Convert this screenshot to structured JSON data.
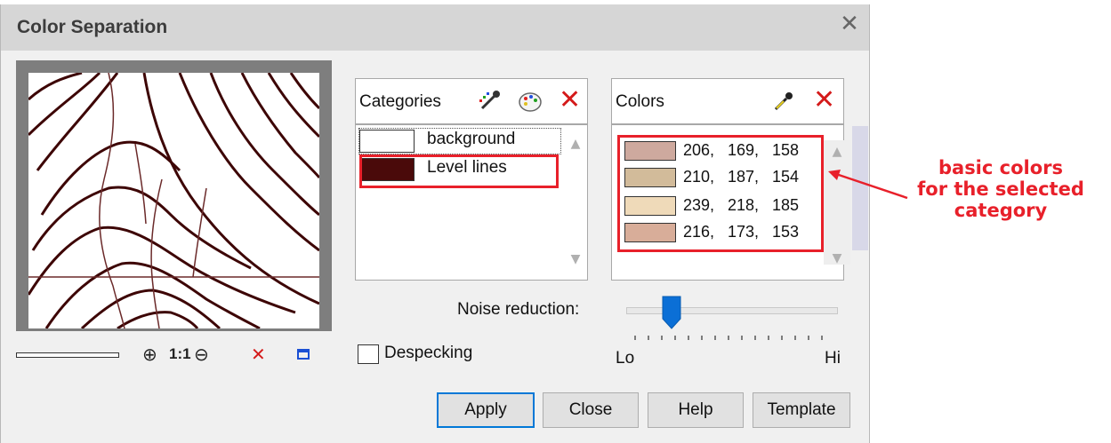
{
  "dialog": {
    "title": "Color Separation",
    "close_icon": "close-icon"
  },
  "preview": {
    "tools": {
      "zoom_in_icon": "zoom-in-icon",
      "one_to_one_label": "1:1",
      "zoom_out_icon": "zoom-out-icon",
      "delete_icon": "delete-icon",
      "window_icon": "window-icon"
    }
  },
  "categories": {
    "header": "Categories",
    "items": [
      {
        "label": "background",
        "swatch": "#ffffff"
      },
      {
        "label": "Level lines",
        "swatch": "#4a0a0a"
      }
    ]
  },
  "colors": {
    "header": "Colors",
    "items": [
      {
        "r": "206,",
        "g": "169,",
        "b": "158",
        "swatch": "#cea99e"
      },
      {
        "r": "210,",
        "g": "187,",
        "b": "154",
        "swatch": "#d2bb9a"
      },
      {
        "r": "239,",
        "g": "218,",
        "b": "185",
        "swatch": "#efdab9"
      },
      {
        "r": "216,",
        "g": "173,",
        "b": "153",
        "swatch": "#d8ad99"
      }
    ]
  },
  "noise": {
    "label": "Noise reduction:",
    "low_label": "Lo",
    "high_label": "Hi",
    "level": 0.19
  },
  "despeckling": {
    "label": "Despecking",
    "checked": false
  },
  "buttons": {
    "apply": "Apply",
    "close": "Close",
    "help": "Help",
    "template": "Template"
  },
  "annotation": {
    "line1": "basic colors",
    "line2": "for the selected",
    "line3": "category",
    "color": "#e8202a"
  }
}
